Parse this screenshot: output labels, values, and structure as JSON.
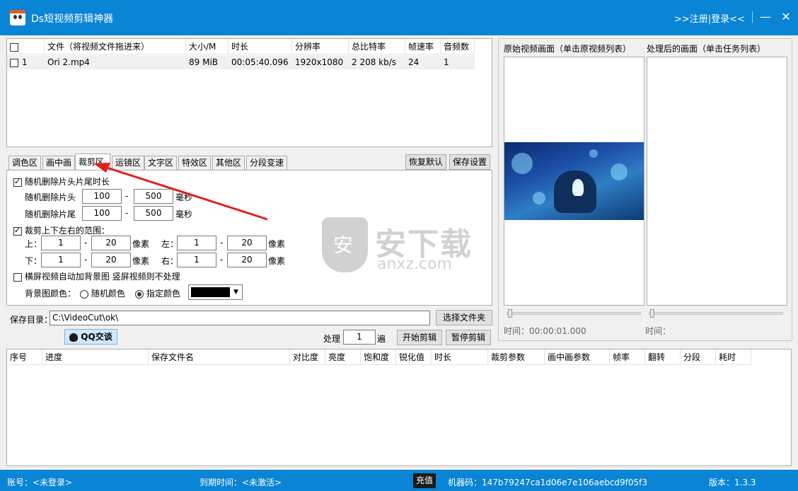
{
  "app": {
    "title": "Ds短视频剪辑神器",
    "login": ">>注册|登录<<",
    "minimize": "—",
    "close": "✕"
  },
  "file_table": {
    "columns": [
      "文件（将视频文件拖进来）",
      "大小/M",
      "时长",
      "分辨率",
      "总比特率",
      "帧速率",
      "音频数"
    ],
    "rows": [
      {
        "index": "1",
        "file": "Ori 2.mp4",
        "size": "89 MiB",
        "duration": "00:05:40.096",
        "resolution": "1920x1080",
        "bitrate": "2 208 kb/s",
        "fps": "24",
        "audio": "1"
      }
    ]
  },
  "preview": {
    "original_label": "原始视频画面（单击原视频列表）",
    "processed_label": "处理后的画面（单击任务列表）",
    "original_time": "时间：00:00:01.000",
    "processed_time": "时间："
  },
  "tabs": [
    "调色区",
    "画中画",
    "裁剪区",
    "运镜区",
    "文字区",
    "特效区",
    "其他区",
    "分段变速"
  ],
  "active_tab": "裁剪区",
  "buttons": {
    "restore": "恢复默认",
    "save_settings": "保存设置",
    "choose_folder": "选择文件夹",
    "start": "开始剪辑",
    "pause": "暂停剪辑",
    "qq": "QQ交谈"
  },
  "crop": {
    "random_trim_label": "随机删除片头片尾时长",
    "head_label": "随机删除片头",
    "head_min": "100",
    "head_max": "500",
    "head_unit": "毫秒",
    "tail_label": "随机删除片尾",
    "tail_min": "100",
    "tail_max": "500",
    "tail_unit": "毫秒",
    "range_label": "裁剪上下左右的范围：",
    "top_label": "上：",
    "top_min": "1",
    "top_max": "20",
    "left_label": "左：",
    "left_min": "1",
    "left_max": "20",
    "bottom_label": "下：",
    "bottom_min": "1",
    "bottom_max": "20",
    "right_label": "右：",
    "right_min": "1",
    "right_max": "20",
    "px_unit": "像素",
    "dash": "-",
    "bg_label": "横屏视频自动加背景图 竖屏视频则不处理",
    "bg_color_label": "背景图颜色：",
    "random_color": "随机颜色",
    "specified_color": "指定颜色",
    "swatch_color": "#000000"
  },
  "save": {
    "label": "保存目录：",
    "path": "C:\\VideoCut\\ok\\",
    "process_label": "处理",
    "process_count": "1",
    "process_unit": "遍"
  },
  "task_table": {
    "columns": [
      "序号",
      "进度",
      "保存文件名",
      "对比度",
      "亮度",
      "饱和度",
      "锐化值",
      "时长",
      "裁剪参数",
      "画中画参数",
      "帧率",
      "翻转",
      "分段",
      "耗时"
    ]
  },
  "watermark": {
    "brand": "安下载",
    "domain": "anxz.com"
  },
  "status": {
    "account": "账号：<未登录>",
    "expire": "到期时间：<未激活>",
    "recharge": "充值",
    "machine": "机器码：147b79247ca1d06e7e106aebcd9f05f3",
    "version": "版本：1.3.3"
  }
}
